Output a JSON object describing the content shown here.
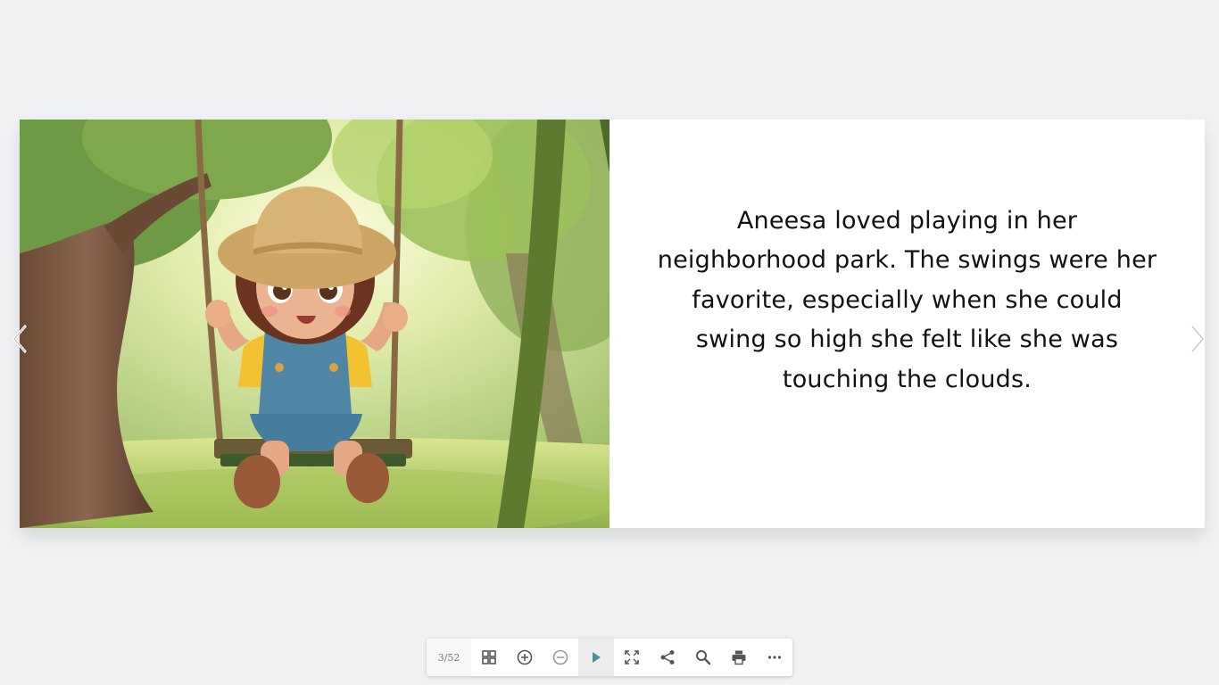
{
  "book": {
    "story_text": "Aneesa loved playing in her neighborhood park. The swings were her favorite, especially when she could swing so high she felt like she was touching the clouds."
  },
  "toolbar": {
    "page_counter": "3/52",
    "buttons": [
      {
        "icon": "grid-icon"
      },
      {
        "icon": "zoom-in-icon"
      },
      {
        "icon": "zoom-out-icon"
      },
      {
        "icon": "play-icon"
      },
      {
        "icon": "fullscreen-icon"
      },
      {
        "icon": "share-icon"
      },
      {
        "icon": "search-icon"
      },
      {
        "icon": "print-icon"
      },
      {
        "icon": "more-icon"
      }
    ]
  },
  "navigation": {
    "prev_icon": "chevron-left-icon",
    "next_icon": "chevron-right-icon"
  },
  "colors": {
    "background": "#f0f1f3",
    "page": "#ffffff",
    "accent_play": "#4a8f9a",
    "icon": "#555555"
  }
}
